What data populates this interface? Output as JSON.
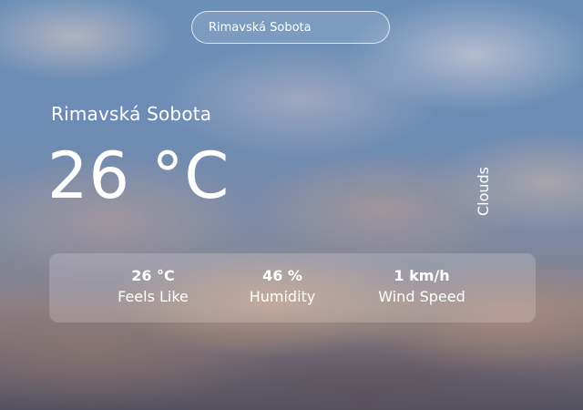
{
  "search": {
    "value": "Rimavská Sobota",
    "placeholder": ""
  },
  "weather": {
    "city": "Rimavská Sobota",
    "temperature": "26 °C",
    "condition": "Clouds"
  },
  "details": {
    "feels_like": {
      "value": "26 °C",
      "label": "Feels Like"
    },
    "humidity": {
      "value": "46 %",
      "label": "Humidity"
    },
    "wind_speed": {
      "value": "1 km/h",
      "label": "Wind Speed"
    }
  },
  "colors": {
    "text": "#ffffff",
    "sky": "#6c8fb8",
    "panel": "rgba(255,255,255,0.18)"
  }
}
